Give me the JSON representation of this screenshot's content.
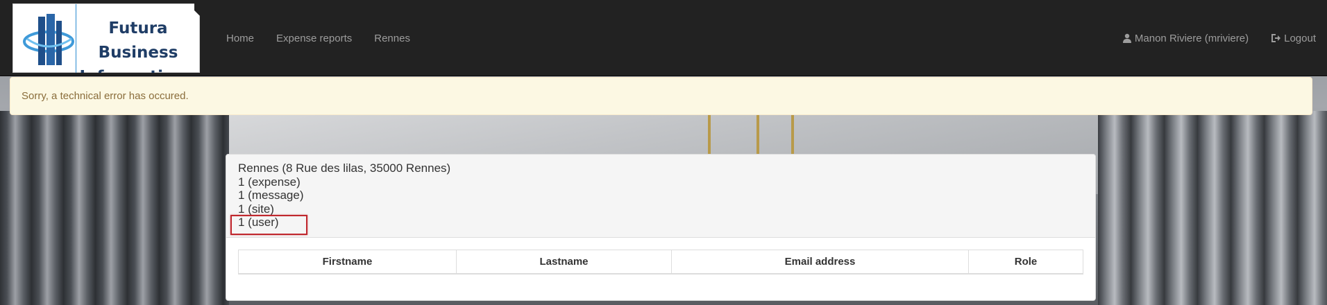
{
  "brand": {
    "logo_text_line1": "Futura Business",
    "logo_text_line2": "Informatique"
  },
  "nav": {
    "links": [
      "Home",
      "Expense reports",
      "Rennes"
    ],
    "user_label": "Manon Riviere (mriviere)",
    "logout_label": "Logout",
    "user_icon": "user-icon",
    "logout_icon": "logout-icon"
  },
  "alert": {
    "message": "Sorry, a technical error has occured."
  },
  "site_panel": {
    "lines": [
      "Rennes (8 Rue des lilas, 35000 Rennes)",
      "1 (expense)",
      "1 (message)",
      "1 (site)",
      "1 (user)"
    ],
    "table_headers": [
      "Firstname",
      "Lastname",
      "Email address",
      "Role"
    ]
  },
  "colors": {
    "navbar_bg": "#222222",
    "nav_text": "#9d9d9d",
    "alert_bg": "#fcf8e3",
    "alert_text": "#8a6d3b",
    "highlight_border": "#c0272d"
  }
}
